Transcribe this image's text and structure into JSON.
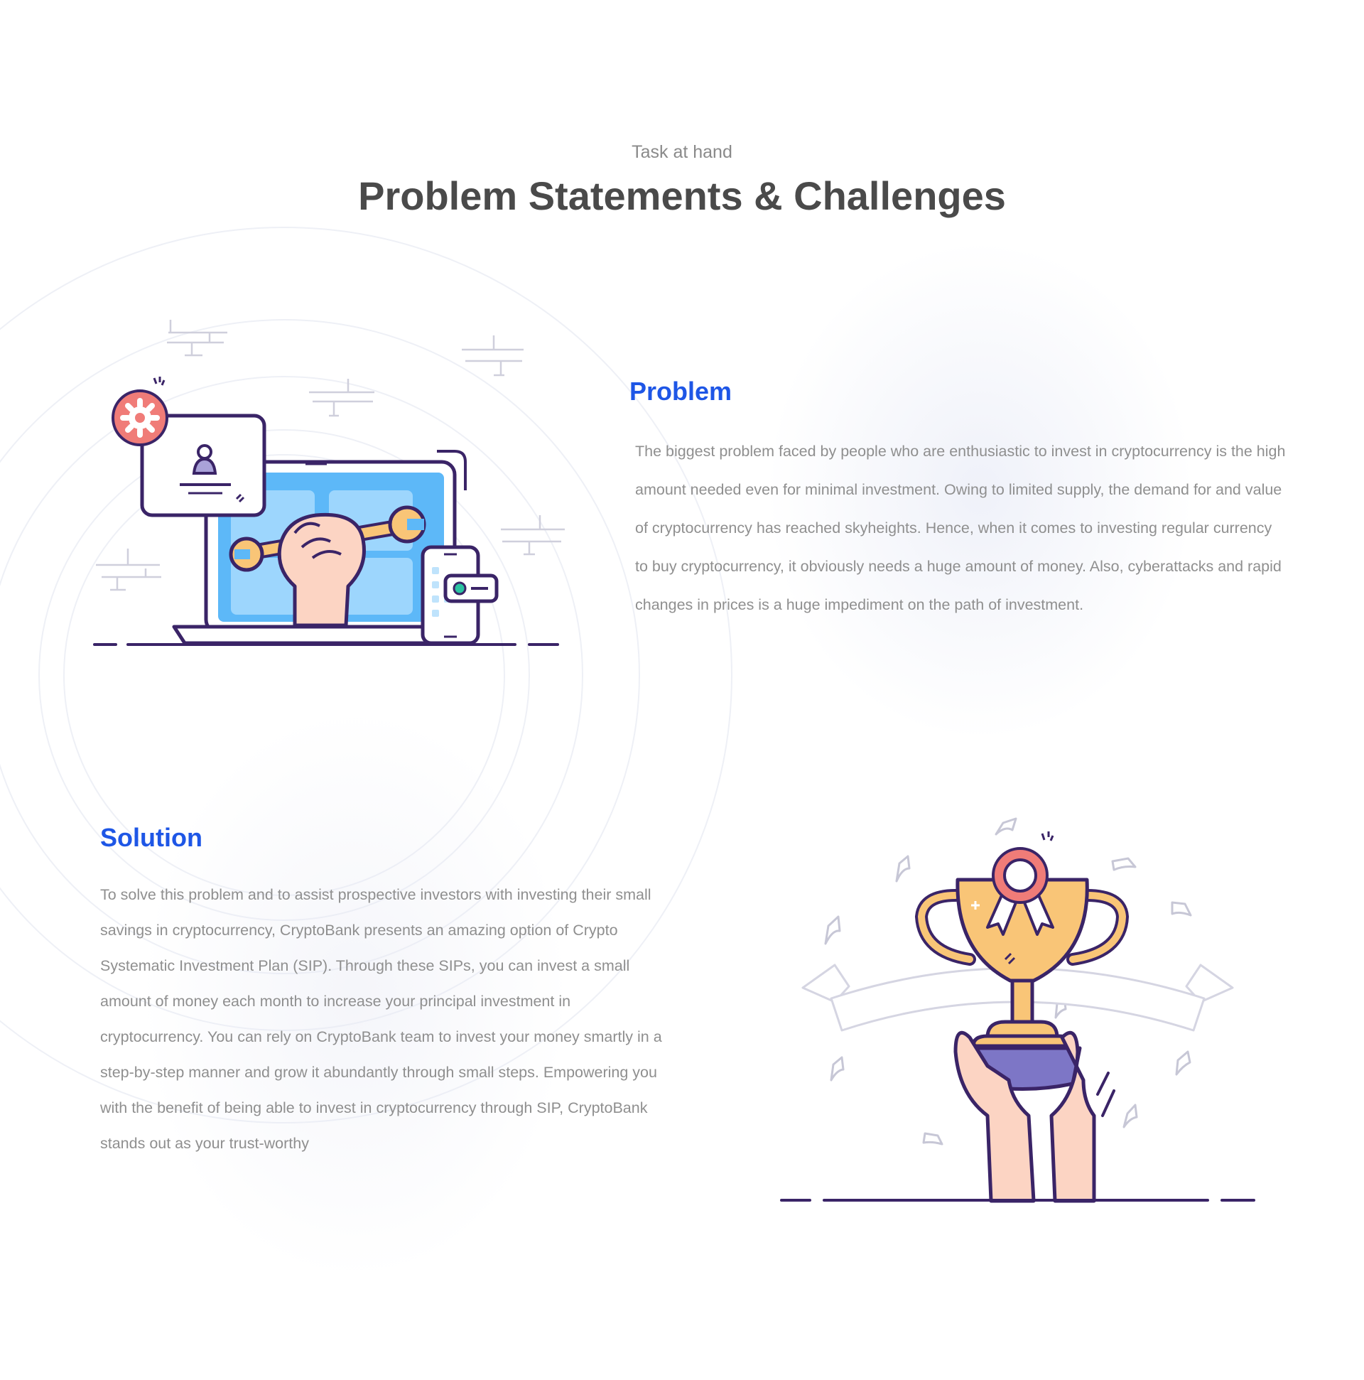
{
  "header": {
    "eyebrow": "Task at hand",
    "title": "Problem Statements & Challenges"
  },
  "problem": {
    "heading": "Problem",
    "text": "The biggest problem faced by people who are enthusiastic to invest in cryptocurrency is the high amount needed even for minimal investment. Owing to limited supply, the demand for and value of cryptocurrency has reached skyheights. Hence, when it comes to investing regular currency to buy cryptocurrency, it obviously needs a huge amount of money. Also, cyberattacks and rapid changes in prices is a huge impediment on the path of investment."
  },
  "solution": {
    "heading": "Solution",
    "text": "To solve this problem and to assist prospective investors with investing their small savings in cryptocurrency, CryptoBank presents an amazing option of Crypto Systematic Investment Plan (SIP). Through these SIPs, you can invest a small amount of money each month to increase your principal investment in cryptocurrency. You can rely on CryptoBank team to invest your money smartly in a step-by-step manner and grow it abundantly through small steps. Empowering you with the benefit of being able to invest in cryptocurrency through SIP, CryptoBank stands out as your trust-worthy"
  },
  "colors": {
    "accent_blue": "#1e56e6",
    "outline_purple": "#3a2467",
    "screen_blue": "#5db8f8",
    "coral": "#f07c78",
    "trophy_gold": "#f9c577",
    "skin": "#fcd4c3",
    "base_purple": "#7d76c6"
  },
  "icons": {
    "problem_illustration": "laptop-wrench-illustration",
    "solution_illustration": "trophy-hands-illustration"
  }
}
